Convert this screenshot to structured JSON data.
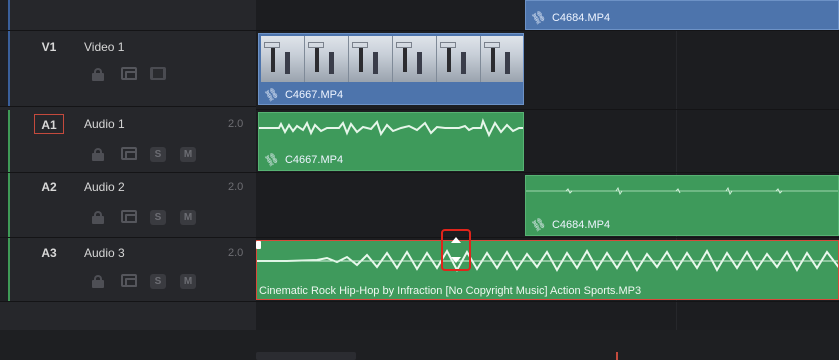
{
  "tracks": [
    {
      "id": "V1",
      "name": "Video 1",
      "channels": ""
    },
    {
      "id": "A1",
      "name": "Audio 1",
      "channels": "2.0"
    },
    {
      "id": "A2",
      "name": "Audio 2",
      "channels": "2.0"
    },
    {
      "id": "A3",
      "name": "Audio 3",
      "channels": "2.0"
    }
  ],
  "buttons": {
    "solo": "S",
    "mute": "M"
  },
  "clips": {
    "v1_top": "C4684.MP4",
    "v1": "C4667.MP4",
    "a1": "C4667.MP4",
    "a2": "C4684.MP4",
    "a3": "Cinematic Rock Hip-Hop by Infraction [No Copyright Music]  Action Sports.MP3"
  },
  "colors": {
    "video_clip": "#4d74ac",
    "audio_clip": "#3e9a5b",
    "selection": "#d8493a",
    "highlight": "#e0241b"
  },
  "icons": [
    "lock-icon",
    "auto-select-icon",
    "film-icon",
    "link-icon",
    "volume-handle-icon"
  ]
}
